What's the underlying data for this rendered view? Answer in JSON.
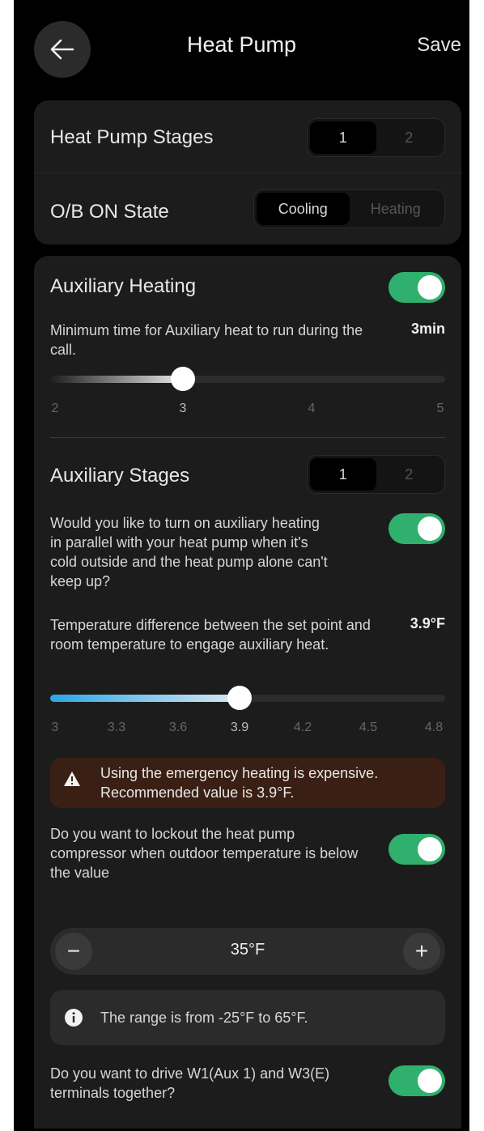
{
  "header": {
    "title": "Heat Pump",
    "save_label": "Save"
  },
  "stages": {
    "label": "Heat Pump Stages",
    "options": [
      "1",
      "2"
    ]
  },
  "ob_state": {
    "label": "O/B ON State",
    "options": [
      "Cooling",
      "Heating"
    ]
  },
  "aux_heating": {
    "label": "Auxiliary Heating",
    "enabled": true,
    "min_time_text": "Minimum time for Auxiliary heat to run during the call.",
    "min_time_value": "3min",
    "slider_ticks": [
      "2",
      "3",
      "4",
      "5"
    ],
    "slider_value": 3
  },
  "aux_stages": {
    "label": "Auxiliary Stages",
    "options": [
      "1",
      "2"
    ],
    "parallel_question": "Would you like to turn on auxiliary heating in parallel with your heat pump when it's cold outside and the heat pump alone can't keep up?",
    "parallel_enabled": true,
    "diff_text": "Temperature difference between the set point and room temperature to engage auxiliary heat.",
    "diff_value": "3.9°F",
    "slider_ticks": [
      "3",
      "3.3",
      "3.6",
      "3.9",
      "4.2",
      "4.5",
      "4.8"
    ],
    "slider_value": 3.9
  },
  "warning": {
    "text": "Using the emergency heating is expensive. Recommended value is 3.9°F."
  },
  "lockout": {
    "question": "Do you want to lockout the heat pump compressor when outdoor temperature is below the value",
    "enabled": true,
    "value": "35°F",
    "minus": "−",
    "plus": "+"
  },
  "range_info": {
    "text": "The range is from -25°F to 65°F."
  },
  "w1w3": {
    "question": "Do you want to drive W1(Aux 1) and W3(E) terminals together?",
    "enabled": true
  },
  "colors": {
    "accent_green": "#2fb06c",
    "slider_blue": "#2aa6e8",
    "warning_bg": "#3a2014"
  }
}
